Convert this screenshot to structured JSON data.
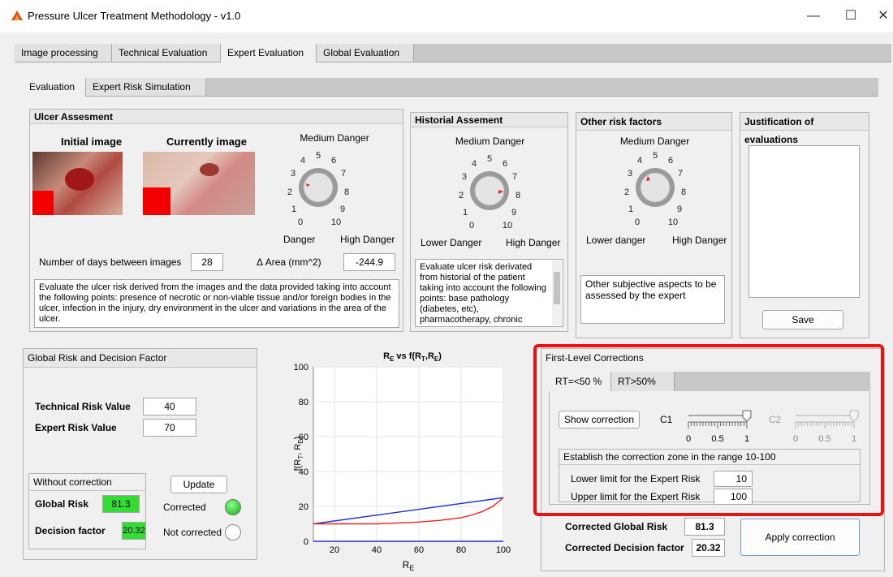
{
  "window": {
    "title": "Pressure Ulcer Treatment Methodology - v1.0",
    "min": "—",
    "max": "☐",
    "close": "✕"
  },
  "main_tabs": [
    "Image processing",
    "Technical Evaluation",
    "Expert Evaluation",
    "Global Evaluation"
  ],
  "sub_tabs": [
    "Evaluation",
    "Expert Risk Simulation"
  ],
  "ulcer": {
    "title": "Ulcer Assesment",
    "initial_label": "Initial image",
    "current_label": "Currently image",
    "dial_title": "Medium Danger",
    "dial_low": "Danger",
    "dial_high": "High Danger",
    "days_label": "Number of days between images",
    "days_value": "28",
    "area_label": "Δ Area (mm^2)",
    "area_value": "-244.9",
    "description": "Evaluate the ulcer risk derived from the images and the data provided taking into account the following points: presence of necrotic or non-viable tissue and/or foreign bodies in the ulcer, infection in the injury, dry environment in the ulcer and  variations in the area of the ulcer."
  },
  "historial": {
    "title": "Historial Assement",
    "dial_title": "Medium Danger",
    "dial_low": "Lower Danger",
    "dial_high": "High Danger",
    "description": "Evaluate ulcer risk derivated from historial of the patient taking into account the following points: base pathology (diabetes, etc), pharmacotherapy, chronic"
  },
  "other": {
    "title": "Other risk factors",
    "dial_title": "Medium Danger",
    "dial_low": "Lower danger",
    "dial_high": "High Danger",
    "description": "Other subjective aspects to be assessed by the expert"
  },
  "justification": {
    "title": "Justification of evaluations",
    "save": "Save"
  },
  "dial_ticks": [
    "0",
    "1",
    "2",
    "3",
    "4",
    "5",
    "6",
    "7",
    "8",
    "9",
    "10"
  ],
  "global": {
    "title": "Global Risk and Decision Factor",
    "technical_label": "Technical Risk Value",
    "technical_value": "40",
    "expert_label": "Expert Risk Value",
    "expert_value": "70",
    "without_title": "Without correction",
    "update": "Update",
    "global_risk_label": "Global Risk",
    "global_risk_value": "81.3",
    "decision_label": "Decision factor",
    "decision_value": "20.32",
    "corrected_label": "Corrected",
    "not_corrected_label": "Not corrected"
  },
  "chart_data": {
    "type": "line",
    "title": "R_E vs f(R_T,R_E)",
    "xlabel": "R_E",
    "ylabel": "f(R_T, R_E)",
    "xlim": [
      10,
      100
    ],
    "ylim": [
      0,
      100
    ],
    "xticks": [
      20,
      40,
      60,
      80,
      100
    ],
    "yticks": [
      0,
      20,
      40,
      60,
      80,
      100
    ],
    "grid": true,
    "series": [
      {
        "color": "#2233cc",
        "x": [
          10,
          100
        ],
        "y": [
          10,
          25
        ]
      },
      {
        "color": "#ee2222",
        "x": [
          10,
          20,
          30,
          40,
          50,
          60,
          70,
          80,
          85,
          90,
          95,
          100
        ],
        "y": [
          10,
          10,
          10,
          10,
          10.5,
          11,
          12,
          13.5,
          15,
          17,
          20,
          25
        ]
      },
      {
        "color": "#2233cc",
        "x": [
          10,
          100
        ],
        "y": [
          0,
          0
        ]
      }
    ]
  },
  "corrections": {
    "title": "First-Level Corrections",
    "tabs": [
      "RT=<50 %",
      "RT>50%"
    ],
    "show": "Show correction",
    "c1_label": "C1",
    "c2_label": "C2",
    "c1_value": 1,
    "c2_value": 1,
    "slider_ticks": [
      "0",
      "0.5",
      "1"
    ],
    "zone_title": "Establish the correction zone in the range 10-100",
    "lower_label": "Lower limit for the Expert Risk",
    "lower_value": "10",
    "upper_label": "Upper limit for the Expert Risk",
    "upper_value": "100"
  },
  "corrected": {
    "global_label": "Corrected Global Risk",
    "global_value": "81.3",
    "decision_label": "Corrected Decision factor",
    "decision_value": "20.32",
    "apply": "Apply correction"
  }
}
